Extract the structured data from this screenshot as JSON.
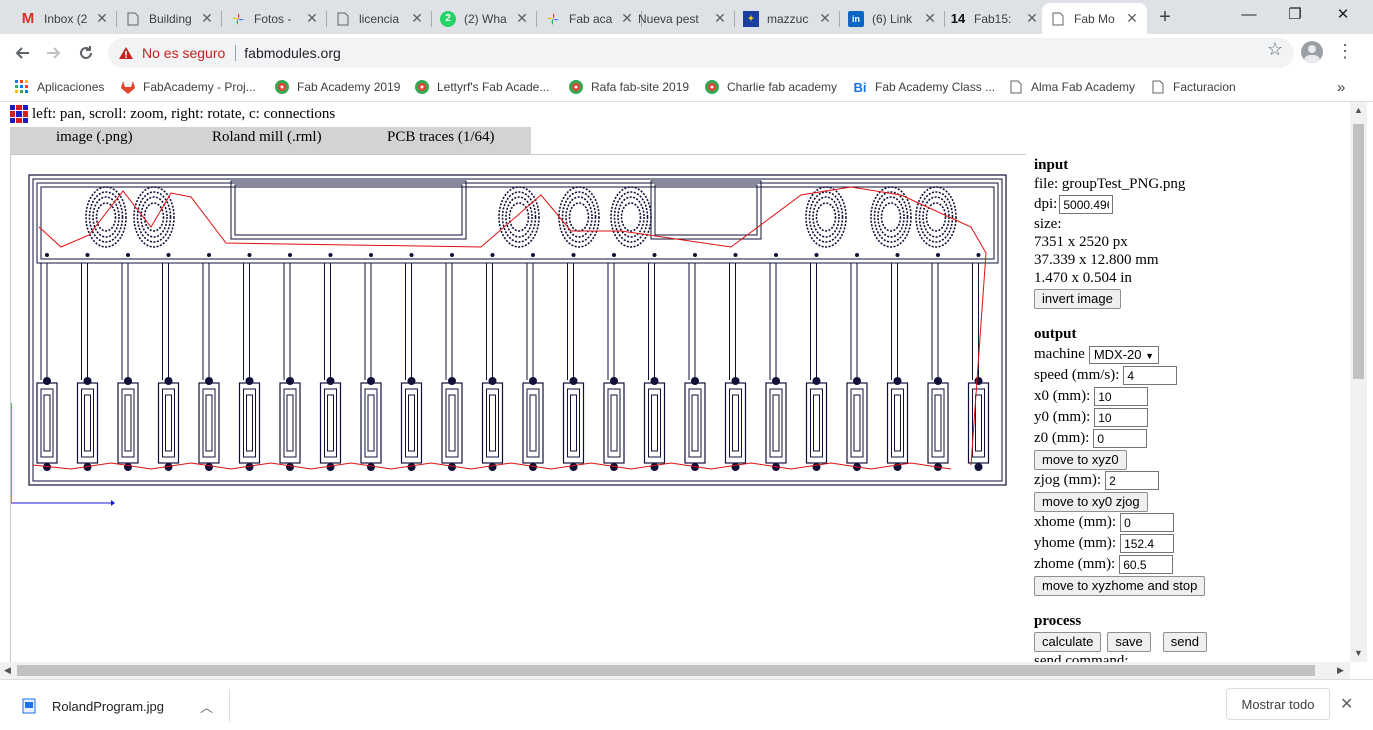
{
  "browser": {
    "tabs": [
      {
        "title": "Inbox (2",
        "icon": "gmail-icon",
        "badge": "2"
      },
      {
        "title": "Building",
        "icon": "document-icon"
      },
      {
        "title": "Fotos -",
        "icon": "pinwheel-icon"
      },
      {
        "title": "licencia",
        "icon": "document-icon"
      },
      {
        "title": "(2) Wha",
        "icon": "whatsapp-icon",
        "badge": "2"
      },
      {
        "title": "Fab aca",
        "icon": "pinwheel-icon"
      },
      {
        "title": "Nueva pest",
        "icon": ""
      },
      {
        "title": "mazzuc",
        "icon": "eu-flag-icon"
      },
      {
        "title": "(6) Link",
        "icon": "linkedin-icon",
        "badge": "in"
      },
      {
        "title": "Fab15:",
        "icon": "fab15-icon",
        "badge": "14"
      },
      {
        "title": "Fab Mo",
        "icon": "document-icon"
      }
    ],
    "new_tab": "+",
    "security_warning": "No es seguro",
    "url": "fabmodules.org",
    "bookmarks": [
      {
        "label": "Aplicaciones",
        "icon": "apps-grid-icon"
      },
      {
        "label": "FabAcademy - Proj...",
        "icon": "gitlab-icon"
      },
      {
        "label": "Fab Academy 2019",
        "icon": "fablab-icon"
      },
      {
        "label": "Lettyrf's Fab Acade...",
        "icon": "fablab-icon"
      },
      {
        "label": "Rafa fab-site 2019",
        "icon": "fablab-icon"
      },
      {
        "label": "Charlie fab academy",
        "icon": "fablab-icon"
      },
      {
        "label": "Fab Academy Class ...",
        "icon": "bit-icon"
      },
      {
        "label": "Alma Fab Academy",
        "icon": "document-icon"
      },
      {
        "label": "Facturacion",
        "icon": "document-icon"
      }
    ],
    "more_bookmarks": "»"
  },
  "page": {
    "instructions": "left: pan, scroll: zoom, right: rotate, c: connections",
    "menus": [
      "image (.png)",
      "Roland mill (.rml)",
      "PCB traces (1/64)"
    ],
    "input": {
      "heading": "input",
      "file_label": "file:",
      "file_name": "groupTest_PNG.png",
      "dpi_label": "dpi:",
      "dpi_value": "5000.496",
      "size_label": "size:",
      "size_px": "7351 x 2520 px",
      "size_mm": "37.339 x 12.800 mm",
      "size_in": "1.470 x 0.504 in",
      "invert_button": "invert image"
    },
    "output": {
      "heading": "output",
      "machine_label": "machine",
      "machine_value": "MDX-20",
      "speed_label": "speed (mm/s):",
      "speed_value": "4",
      "x0_label": "x0 (mm):",
      "x0_value": "10",
      "y0_label": "y0 (mm):",
      "y0_value": "10",
      "z0_label": "z0 (mm):",
      "z0_value": "0",
      "move_xyz0_button": "move to xyz0",
      "zjog_label": "zjog (mm):",
      "zjog_value": "2",
      "move_xy0_button": "move to xy0 zjog",
      "xhome_label": "xhome (mm):",
      "xhome_value": "0",
      "yhome_label": "yhome (mm):",
      "yhome_value": "152.4",
      "zhome_label": "zhome (mm):",
      "zhome_value": "60.5",
      "move_home_button": "move to xyzhome and stop"
    },
    "process": {
      "heading": "process",
      "calculate_button": "calculate",
      "save_button": "save",
      "send_button": "send",
      "send_command_label": "send command:"
    },
    "toolpath": {
      "trace_color": "#101038",
      "connection_color": "#e01010"
    }
  },
  "downloads": {
    "file": "RolandProgram.jpg",
    "show_all": "Mostrar todo"
  }
}
